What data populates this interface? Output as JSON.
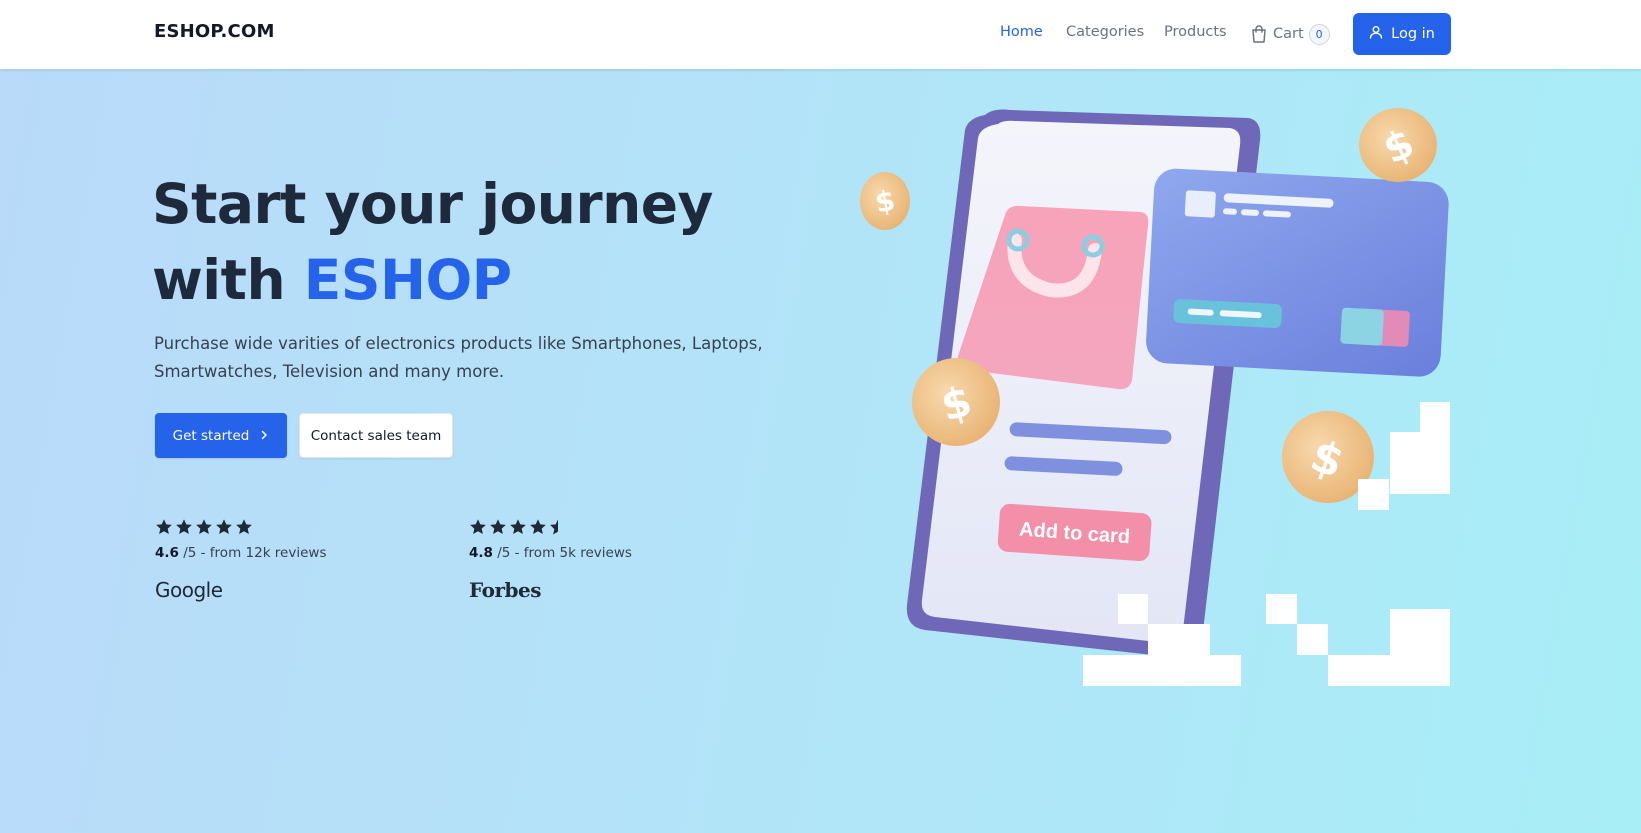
{
  "nav": {
    "brand": "ESHOP.COM",
    "links": [
      {
        "label": "Home",
        "active": true
      },
      {
        "label": "Categories",
        "active": false
      },
      {
        "label": "Products",
        "active": false
      }
    ],
    "cart": {
      "label": "Cart",
      "count": "0",
      "icon": "shopping-bag-icon"
    },
    "login": {
      "label": "Log in",
      "icon": "user-icon"
    }
  },
  "hero": {
    "title_line1": "Start your journey",
    "title_line2_prefix": "with ",
    "title_accent": "ESHOP",
    "description": "Purchase wide varities of electronics products like Smartphones, Laptops, Smartwatches, Television and many more.",
    "primary_button": {
      "label": "Get started",
      "icon": "chevron-right-icon"
    },
    "secondary_button": {
      "label": "Contact sales team"
    }
  },
  "ratings": [
    {
      "score": "4.6",
      "suffix": " /5 - from 12k reviews",
      "stars": 5,
      "source": "Google"
    },
    {
      "score": "4.8",
      "suffix": " /5 - from 5k reviews",
      "stars": 4.5,
      "source": "Forbes"
    }
  ],
  "illustration": {
    "button_text": "Add to card"
  },
  "colors": {
    "accent": "#2563eb",
    "heading": "#1e293b",
    "background_start": "#b9daf9",
    "background_end": "#a8eef7"
  }
}
